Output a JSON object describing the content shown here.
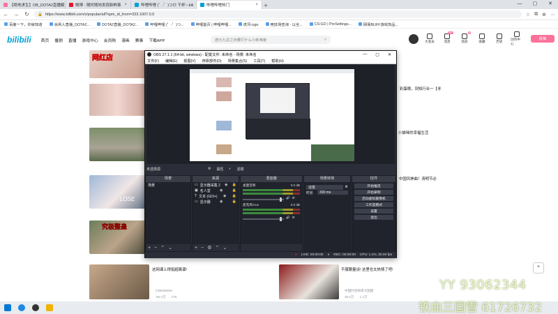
{
  "browser": {
    "tabs": [
      {
        "label": "【绝地求生】OB_DOTA2直播解说短视",
        "color": "#fb7299",
        "active": false
      },
      {
        "label": "微博 - 随时随地发现新鲜事",
        "color": "#e6162d",
        "active": false
      },
      {
        "label": "哔哩哔哩 (゜-゜)つロ 干杯~-bili",
        "color": "#00a1d6",
        "active": false
      },
      {
        "label": "哔哩哔哩热门",
        "color": "#00a1d6",
        "active": true
      }
    ],
    "url": "https://www.bilibili.com/v/popular/all?spm_id_from=333.1007.0.0",
    "bookmarks": [
      "百度一下，你就知道",
      "余烬人直播_DOTA2...",
      "DOTA2直播_DOTA2...",
      "哔哩哔哩 (゜-゜)つ...",
      "哔哩首页 | 哔哩哔哩...",
      "虎牙csgo",
      "竞技场查询 - 以全...",
      "CS:GO | ProSettings...",
      "网易BUFF游戏饰品..."
    ]
  },
  "site": {
    "logo": "bilibili",
    "nav": [
      "首页",
      "番剧",
      "直播",
      "游戏中心",
      "会员购",
      "漫画",
      "赛事",
      "下载APP"
    ],
    "search_placeholder": "唐元九龙之存腰打什么小新难度",
    "right_nav": [
      {
        "label": "大会员",
        "badge": ""
      },
      {
        "label": "消息",
        "badge": "99+"
      },
      {
        "label": "动态",
        "badge": "8"
      },
      {
        "label": "收藏",
        "badge": ""
      },
      {
        "label": "历史",
        "badge": ""
      },
      {
        "label": "创作中心",
        "badge": ""
      }
    ],
    "upload_label": "投稿"
  },
  "feed": {
    "items": [
      {
        "title": "彩蛋眼，到知行合一【寻",
        "meta": ""
      },
      {
        "title": "小猫咪的幸福生活",
        "meta": ""
      },
      {
        "title": "中国风神曲！清明节必",
        "meta": ""
      },
      {
        "title": "这网课上得挺超离谱!",
        "meta": "小BEMMMS"
      },
      {
        "title": "不服跟量谈! 这里也太热情了吧!",
        "meta": "中国时尚频率大国猿"
      }
    ],
    "stats1": [
      "86.4万",
      "278"
    ],
    "stats2": [
      "36.5万",
      "1.1万"
    ],
    "thumb_caption_1": "网红店",
    "thumb_caption_2": "究极整蛊",
    "thumb_caption_3": "LOSE"
  },
  "obs": {
    "title": "OBS 27.1.1 (64-bit, windows) - 配置文件: 未命名 - 场景: 未命名",
    "menu": [
      "文件(F)",
      "编辑(E)",
      "视图(V)",
      "停靠部件(D)",
      "场景集合(S)",
      "工具(T)",
      "帮助(H)"
    ],
    "scene_info": [
      "未选择源",
      "属性",
      "滤镜"
    ],
    "docks": {
      "scenes": {
        "header": "场景",
        "items": [
          "场景"
        ]
      },
      "sources": {
        "header": "来源",
        "items": [
          "显示器采集 2",
          "名人堂",
          "文本 (GDI+)",
          "显示器"
        ]
      },
      "mixer": {
        "header": "混音器",
        "channels": [
          {
            "name": "桌面音频",
            "db": "0.0 dB"
          },
          {
            "name": "麦克风/Aux",
            "db": "0.0 dB"
          }
        ]
      },
      "transitions": {
        "header": "场景转场",
        "type": "淡变",
        "duration_label": "时长",
        "duration": "300 ms"
      },
      "controls": {
        "header": "控件",
        "buttons": [
          "开始推流",
          "开始录制",
          "启动虚拟摄像机",
          "工作室模式",
          "设置",
          "退出"
        ]
      }
    },
    "status": [
      "LIVE: 00:00:00",
      "REC: 00:00:00",
      "CPU: 1.1%, 30.00 fps"
    ]
  },
  "overlay": {
    "yy_text": "YY 93062344",
    "channel_text": "铁血三国雪 61726732"
  }
}
